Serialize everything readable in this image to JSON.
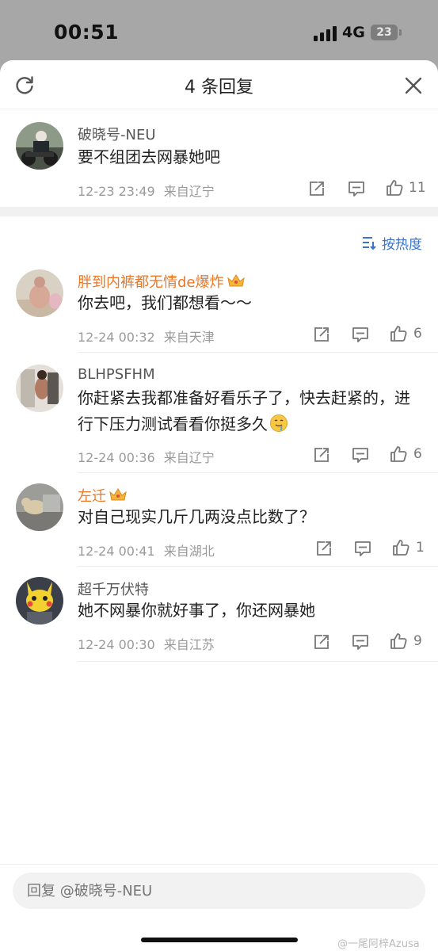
{
  "status_bar": {
    "time": "00:51",
    "network": "4G",
    "battery": "23"
  },
  "header": {
    "title": "4 条回复"
  },
  "main_comment": {
    "username": "破晓号-NEU",
    "text": "要不组团去网暴她吧",
    "date": "12-23 23:49",
    "location": "来自辽宁",
    "likes": "11"
  },
  "sort": {
    "label": "按热度"
  },
  "replies": [
    {
      "username": "胖到内裤都无情de爆炸",
      "text": "你去吧，我们都想看～～",
      "date": "12-24 00:32",
      "location": "来自天津",
      "likes": "6"
    },
    {
      "username": "BLHPSFHM",
      "text": "你赶紧去我都准备好看乐子了，快去赶紧的，进行下压力测试看看你挺多久",
      "date": "12-24 00:36",
      "location": "来自辽宁",
      "likes": "6"
    },
    {
      "username": "左迁",
      "text": "对自己现实几斤几两没点比数了？",
      "date": "12-24 00:41",
      "location": "来自湖北",
      "likes": "1"
    },
    {
      "username": "超千万伏特",
      "text": "她不网暴你就好事了，你还网暴她",
      "date": "12-24 00:30",
      "location": "来自江苏",
      "likes": "9"
    }
  ],
  "reply_box": {
    "placeholder": "回复 @破晓号-NEU"
  },
  "watermark": "@一尾阿梓Azusa",
  "colors": {
    "vip_name": "#ec7623",
    "sort_link": "#3a73c9",
    "meta": "#9a9a9a"
  }
}
